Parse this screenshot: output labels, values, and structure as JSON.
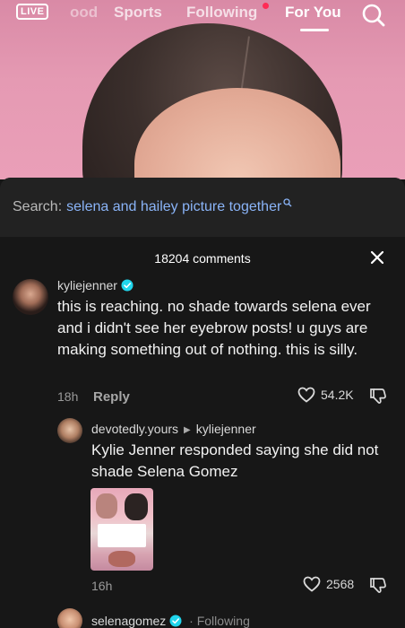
{
  "topnav": {
    "live_label": "LIVE",
    "tabs": [
      "ood",
      "Sports",
      "Following",
      "For You"
    ],
    "active_tab": "For You"
  },
  "search": {
    "prefix": "Search:",
    "query": "selena and hailey picture together"
  },
  "comments": {
    "count_label": "18204 comments",
    "items": [
      {
        "username": "kyliejenner",
        "verified": true,
        "text": "this is reaching. no shade towards selena ever and i didn't see her eyebrow posts! u guys are making something out of nothing. this is silly.",
        "time": "18h",
        "reply_label": "Reply",
        "likes": "54.2K"
      },
      {
        "username": "devotedly.yours",
        "reply_to": "kyliejenner",
        "text": "Kylie Jenner responded saying she did not shade Selena Gomez",
        "time": "16h",
        "likes": "2568"
      },
      {
        "username": "selenagomez",
        "verified": true,
        "following_label": "· Following"
      }
    ]
  },
  "colors": {
    "accent_search": "#8ab4f8",
    "verified_badge": "#20d5ec",
    "live_dot": "#ff2b55"
  }
}
